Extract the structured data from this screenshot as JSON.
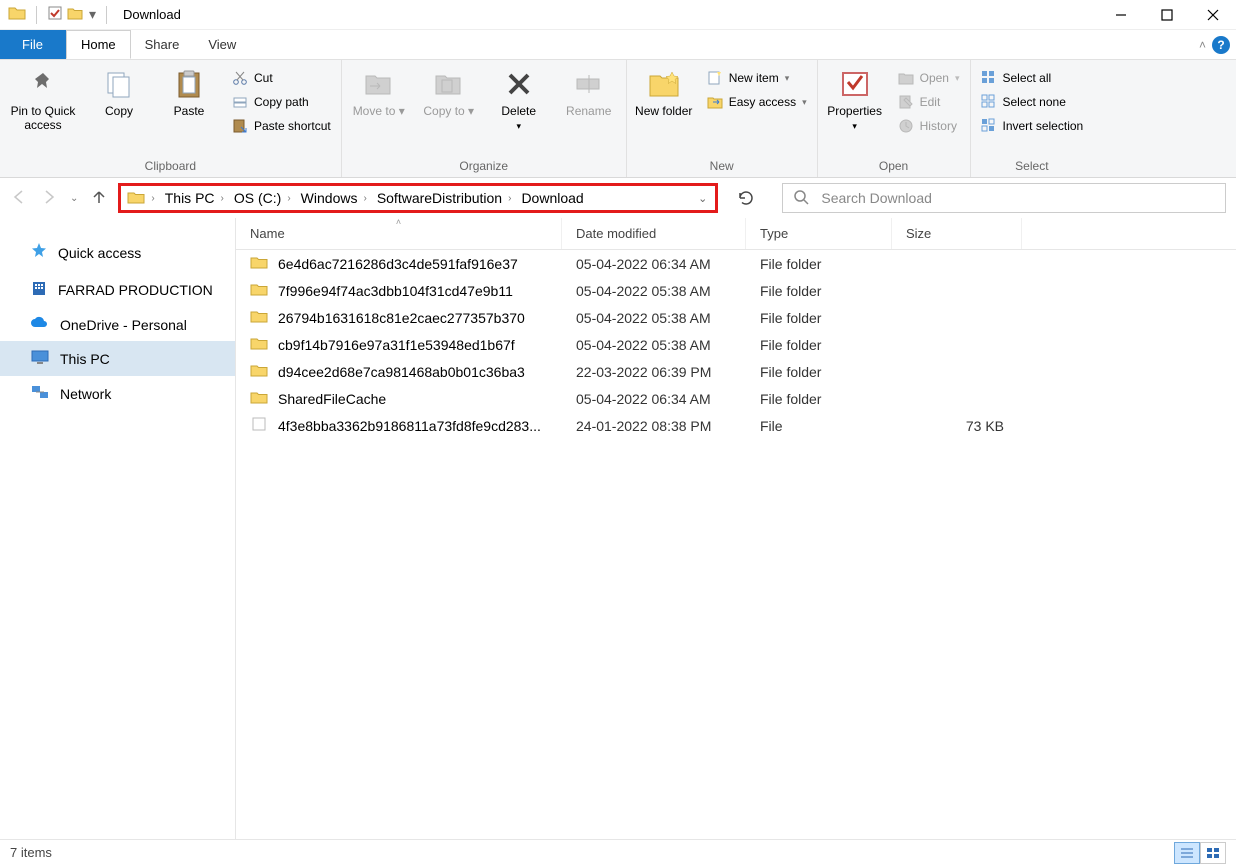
{
  "window": {
    "title": "Download"
  },
  "tabs": {
    "file": "File",
    "home": "Home",
    "share": "Share",
    "view": "View"
  },
  "ribbon": {
    "clipboard": {
      "label": "Clipboard",
      "pin": "Pin to Quick access",
      "copy": "Copy",
      "paste": "Paste",
      "cut": "Cut",
      "copy_path": "Copy path",
      "paste_shortcut": "Paste shortcut"
    },
    "organize": {
      "label": "Organize",
      "move_to": "Move to",
      "copy_to": "Copy to",
      "delete": "Delete",
      "rename": "Rename"
    },
    "new": {
      "label": "New",
      "new_folder": "New folder",
      "new_item": "New item",
      "easy_access": "Easy access"
    },
    "open": {
      "label": "Open",
      "properties": "Properties",
      "open": "Open",
      "edit": "Edit",
      "history": "History"
    },
    "select": {
      "label": "Select",
      "select_all": "Select all",
      "select_none": "Select none",
      "invert": "Invert selection"
    }
  },
  "breadcrumb": {
    "items": [
      "This PC",
      "OS (C:)",
      "Windows",
      "SoftwareDistribution",
      "Download"
    ]
  },
  "search": {
    "placeholder": "Search Download"
  },
  "sidebar": {
    "quick_access": "Quick access",
    "farrad": "FARRAD PRODUCTION",
    "onedrive": "OneDrive - Personal",
    "this_pc": "This PC",
    "network": "Network"
  },
  "columns": {
    "name": "Name",
    "date": "Date modified",
    "type": "Type",
    "size": "Size"
  },
  "files": [
    {
      "name": "6e4d6ac7216286d3c4de591faf916e37",
      "date": "05-04-2022 06:34 AM",
      "type": "File folder",
      "size": "",
      "kind": "folder"
    },
    {
      "name": "7f996e94f74ac3dbb104f31cd47e9b11",
      "date": "05-04-2022 05:38 AM",
      "type": "File folder",
      "size": "",
      "kind": "folder"
    },
    {
      "name": "26794b1631618c81e2caec277357b370",
      "date": "05-04-2022 05:38 AM",
      "type": "File folder",
      "size": "",
      "kind": "folder"
    },
    {
      "name": "cb9f14b7916e97a31f1e53948ed1b67f",
      "date": "05-04-2022 05:38 AM",
      "type": "File folder",
      "size": "",
      "kind": "folder"
    },
    {
      "name": "d94cee2d68e7ca981468ab0b01c36ba3",
      "date": "22-03-2022 06:39 PM",
      "type": "File folder",
      "size": "",
      "kind": "folder"
    },
    {
      "name": "SharedFileCache",
      "date": "05-04-2022 06:34 AM",
      "type": "File folder",
      "size": "",
      "kind": "folder"
    },
    {
      "name": "4f3e8bba3362b9186811a73fd8fe9cd283...",
      "date": "24-01-2022 08:38 PM",
      "type": "File",
      "size": "73 KB",
      "kind": "file"
    }
  ],
  "status": {
    "items": "7 items"
  }
}
